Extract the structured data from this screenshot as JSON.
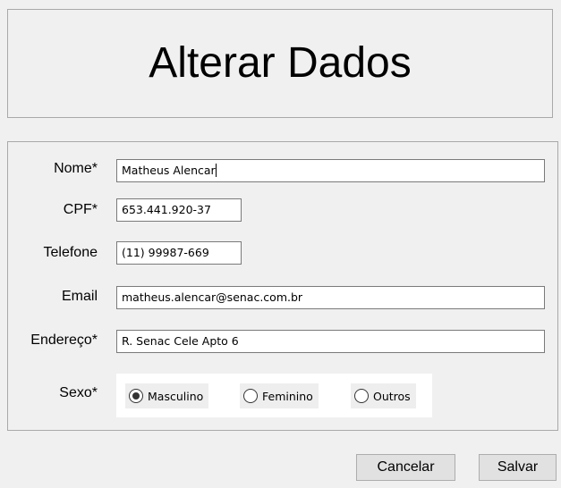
{
  "header": {
    "title": "Alterar Dados"
  },
  "form": {
    "nome": {
      "label": "Nome*",
      "value": "Matheus Alencar"
    },
    "cpf": {
      "label": "CPF*",
      "value": "653.441.920-37"
    },
    "telefone": {
      "label": "Telefone",
      "value": "(11) 99987-669"
    },
    "email": {
      "label": "Email",
      "value": "matheus.alencar@senac.com.br"
    },
    "endereco": {
      "label": "Endereço*",
      "value": "R. Senac Cele Apto 6"
    },
    "sexo": {
      "label": "Sexo*",
      "options": [
        {
          "label": "Masculino",
          "selected": true
        },
        {
          "label": "Feminino",
          "selected": false
        },
        {
          "label": "Outros",
          "selected": false
        }
      ]
    }
  },
  "buttons": {
    "cancel_label": "Cancelar",
    "save_label": "Salvar"
  }
}
